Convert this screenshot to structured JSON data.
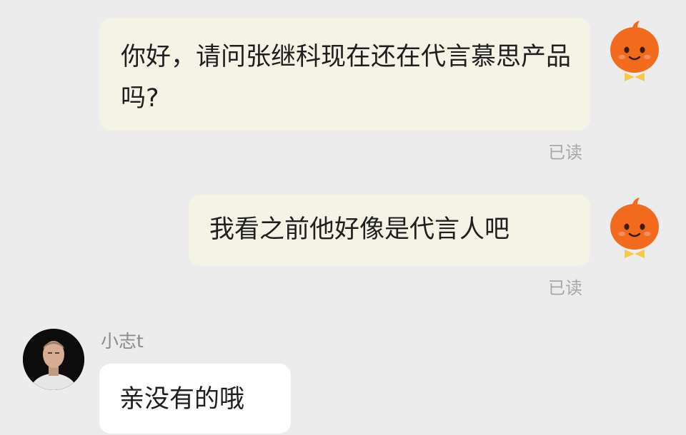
{
  "messages": [
    {
      "text": "你好，请问张继科现在还在代言慕思产品吗?",
      "status": "已读"
    },
    {
      "text": "我看之前他好像是代言人吧",
      "status": "已读"
    },
    {
      "sender": "小志t",
      "text": "亲没有的哦"
    }
  ],
  "colors": {
    "background": "#ececec",
    "outgoing_bubble": "#f4f3e6",
    "incoming_bubble": "#ffffff",
    "read_receipt": "#a7a7a7",
    "avatar_orange": "#f26b1d"
  },
  "icons": {
    "self_avatar": "orange-mascot-icon",
    "other_avatar": "user-photo-avatar"
  }
}
